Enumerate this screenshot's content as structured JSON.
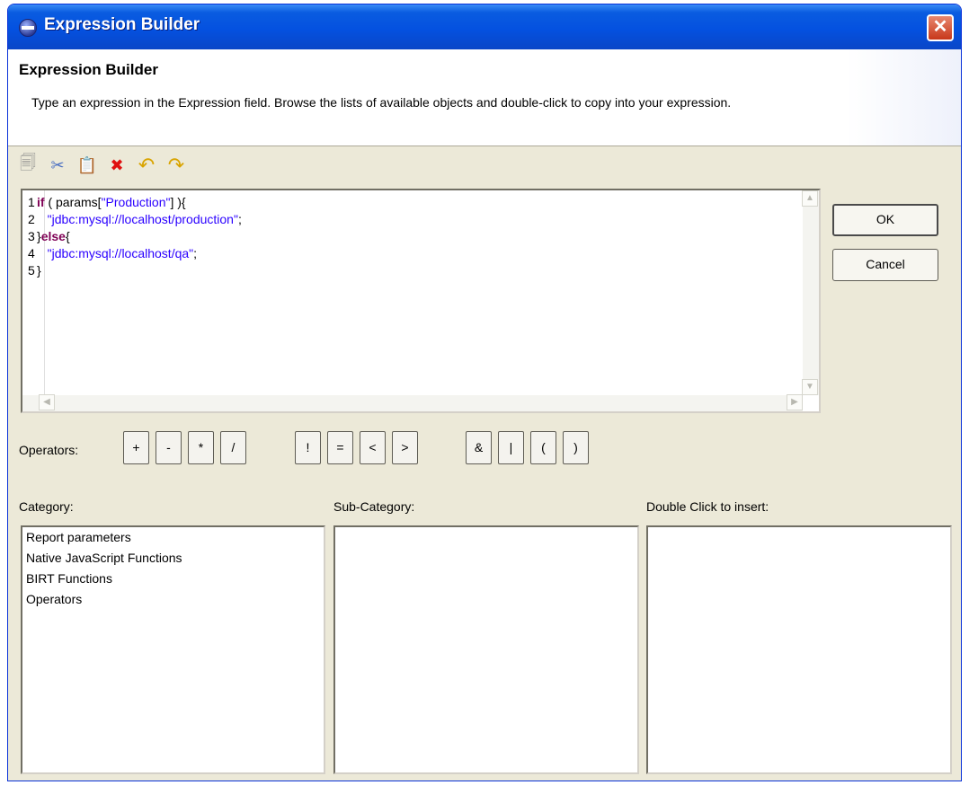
{
  "window": {
    "title": "Expression Builder",
    "close_glyph": "✕"
  },
  "header": {
    "title": "Expression Builder",
    "description": "Type an expression in the Expression field. Browse the lists of available objects and double-click to copy into your expression."
  },
  "toolbar": {
    "icons": [
      "copy-icon",
      "cut-icon",
      "paste-icon",
      "delete-icon",
      "undo-icon",
      "redo-icon"
    ],
    "glyphs": [
      "🗐",
      "✂",
      "📋",
      "✖",
      "↶",
      "↷"
    ]
  },
  "editor": {
    "lines": [
      {
        "num": "1",
        "parts": [
          {
            "t": "if",
            "c": "kw"
          },
          {
            "t": " ( params[",
            "c": ""
          },
          {
            "t": "\"Production\"",
            "c": "str"
          },
          {
            "t": "] ){",
            "c": ""
          }
        ]
      },
      {
        "num": "2",
        "parts": [
          {
            "t": "   ",
            "c": ""
          },
          {
            "t": "\"jdbc:mysql://localhost/production\"",
            "c": "str"
          },
          {
            "t": ";",
            "c": ""
          }
        ]
      },
      {
        "num": "3",
        "parts": [
          {
            "t": "}",
            "c": ""
          },
          {
            "t": "else",
            "c": "kw"
          },
          {
            "t": "{",
            "c": ""
          }
        ]
      },
      {
        "num": "4",
        "parts": [
          {
            "t": "   ",
            "c": ""
          },
          {
            "t": "\"jdbc:mysql://localhost/qa\"",
            "c": "str"
          },
          {
            "t": ";",
            "c": ""
          }
        ]
      },
      {
        "num": "5",
        "parts": [
          {
            "t": "}",
            "c": ""
          }
        ]
      }
    ],
    "scroll_up": "▲",
    "scroll_down": "▼",
    "scroll_left": "◀",
    "scroll_right": "▶"
  },
  "buttons": {
    "ok": "OK",
    "cancel": "Cancel"
  },
  "operators": {
    "label": "Operators:",
    "items": [
      "+",
      "-",
      "*",
      "/",
      "!",
      "=",
      "<",
      ">",
      "&",
      "|",
      "(",
      ")"
    ]
  },
  "panels": {
    "category_label": "Category:",
    "subcategory_label": "Sub-Category:",
    "insert_label": "Double Click to insert:",
    "categories": [
      "Report parameters",
      "Native JavaScript Functions",
      "BIRT Functions",
      "Operators"
    ]
  },
  "colors": {
    "keyword": "#7f0055",
    "string": "#2a00ff",
    "dialog_bg": "#ece9d8",
    "titlebar": "#0451e0"
  }
}
